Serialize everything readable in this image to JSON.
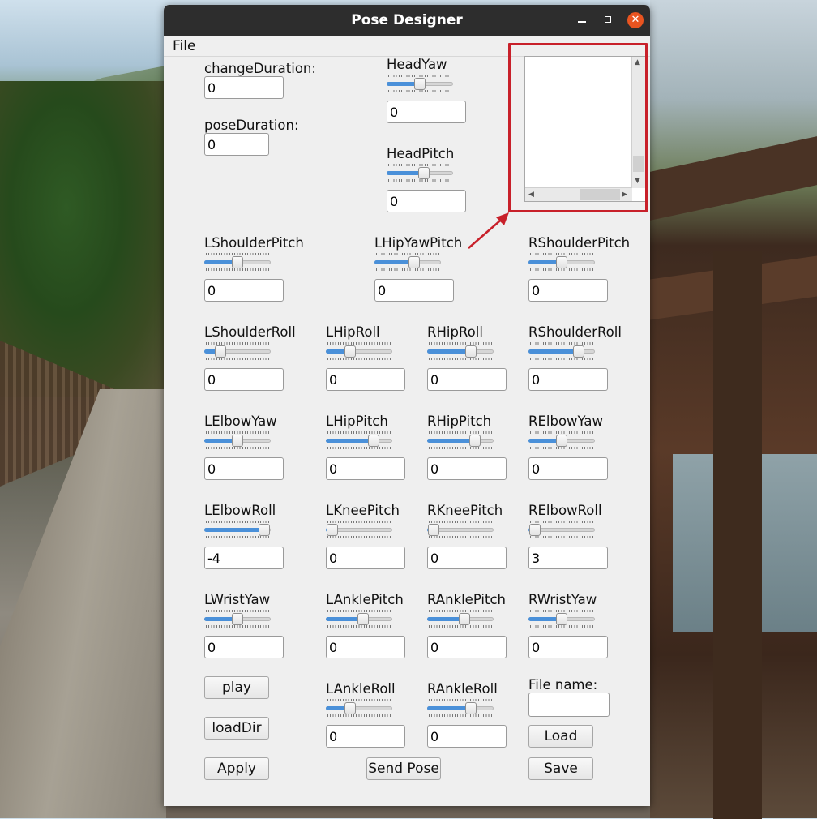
{
  "window": {
    "title": "Pose Designer"
  },
  "menubar": {
    "file": "File"
  },
  "durations": {
    "change_label": "changeDuration:",
    "change_value": "0",
    "pose_label": "poseDuration:",
    "pose_value": "0"
  },
  "joints": {
    "HeadYaw": {
      "label": "HeadYaw",
      "value": "0",
      "level": 0.5
    },
    "HeadPitch": {
      "label": "HeadPitch",
      "value": "0",
      "level": 0.56
    },
    "LShoulderPitch": {
      "label": "LShoulderPitch",
      "value": "0",
      "level": 0.5
    },
    "LHipYawPitch": {
      "label": "LHipYawPitch",
      "value": "0",
      "level": 0.6
    },
    "RShoulderPitch": {
      "label": "RShoulderPitch",
      "value": "0",
      "level": 0.5
    },
    "LShoulderRoll": {
      "label": "LShoulderRoll",
      "value": "0",
      "level": 0.24
    },
    "LHipRoll": {
      "label": "LHipRoll",
      "value": "0",
      "level": 0.36
    },
    "RHipRoll": {
      "label": "RHipRoll",
      "value": "0",
      "level": 0.66
    },
    "RShoulderRoll": {
      "label": "RShoulderRoll",
      "value": "0",
      "level": 0.76
    },
    "LElbowYaw": {
      "label": "LElbowYaw",
      "value": "0",
      "level": 0.5
    },
    "LHipPitch": {
      "label": "LHipPitch",
      "value": "0",
      "level": 0.72
    },
    "RHipPitch": {
      "label": "RHipPitch",
      "value": "0",
      "level": 0.72
    },
    "RElbowYaw": {
      "label": "RElbowYaw",
      "value": "0",
      "level": 0.5
    },
    "LElbowRoll": {
      "label": "LElbowRoll",
      "value": "-4",
      "level": 0.9
    },
    "LKneePitch": {
      "label": "LKneePitch",
      "value": "0",
      "level": 0.1
    },
    "RKneePitch": {
      "label": "RKneePitch",
      "value": "0",
      "level": 0.1
    },
    "RElbowRoll": {
      "label": "RElbowRoll",
      "value": "3",
      "level": 0.1
    },
    "LWristYaw": {
      "label": "LWristYaw",
      "value": "0",
      "level": 0.5
    },
    "LAnklePitch": {
      "label": "LAnklePitch",
      "value": "0",
      "level": 0.56
    },
    "RAnklePitch": {
      "label": "RAnklePitch",
      "value": "0",
      "level": 0.56
    },
    "RWristYaw": {
      "label": "RWristYaw",
      "value": "0",
      "level": 0.5
    },
    "LAnkleRoll": {
      "label": "LAnkleRoll",
      "value": "0",
      "level": 0.36
    },
    "RAnkleRoll": {
      "label": "RAnkleRoll",
      "value": "0",
      "level": 0.66
    }
  },
  "buttons": {
    "play": "play",
    "loadDir": "loadDir",
    "apply": "Apply",
    "send_pose": "Send Pose",
    "load": "Load",
    "save": "Save"
  },
  "file": {
    "label": "File name:",
    "value": ""
  },
  "pose_list": {
    "items": []
  },
  "colors": {
    "accent": "#4a90d9",
    "titlebar": "#2d2d2d",
    "close": "#e95420",
    "highlight": "#c8202a"
  }
}
